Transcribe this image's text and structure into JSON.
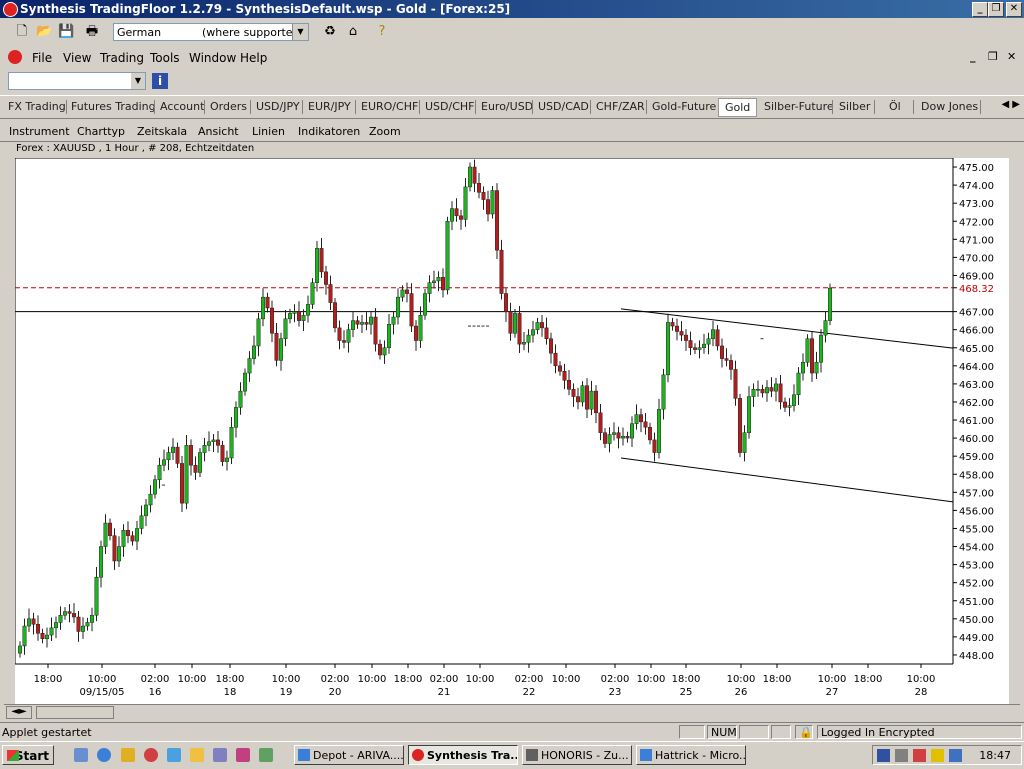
{
  "window": {
    "title": "Synthesis TradingFloor 1.2.79 - SynthesisDefault.wsp - Gold - [Forex:25]"
  },
  "toolbar": {
    "language_value": "German",
    "language_hint": "(where supported)"
  },
  "menu": [
    "File",
    "View",
    "Trading",
    "Tools",
    "Window",
    "Help"
  ],
  "tabs": [
    "FX Trading",
    "Futures Trading",
    "Account",
    "Orders",
    "USD/JPY",
    "EUR/JPY",
    "EURO/CHF",
    "USD/CHF",
    "Euro/USD",
    "USD/CAD",
    "CHF/ZAR",
    "Gold-Future",
    "Gold",
    "Silber-Future",
    "Silber",
    "Öl",
    "Dow Jones"
  ],
  "selected_tab": "Gold",
  "chart_menu": [
    "Instrument",
    "Charttyp",
    "Zeitskala",
    "Ansicht",
    "Linien",
    "Indikatoren",
    "Zoom"
  ],
  "chart_info": "Forex : XAUUSD , 1 Hour , # 208, Echtzeitdaten",
  "chart_data": {
    "type": "candlestick",
    "instrument": "XAUUSD",
    "ylim": [
      447.5,
      475.5
    ],
    "yticks": [
      "475.00",
      "474.00",
      "473.00",
      "472.00",
      "471.00",
      "470.00",
      "469.00",
      "468.32",
      "467.00",
      "466.00",
      "465.00",
      "464.00",
      "463.00",
      "462.00",
      "461.00",
      "460.00",
      "459.00",
      "458.00",
      "457.00",
      "456.00",
      "455.00",
      "454.00",
      "453.00",
      "452.00",
      "451.00",
      "450.00",
      "449.00",
      "448.00"
    ],
    "current_price": 468.32,
    "horizontal_line": 467.0,
    "xticks": [
      {
        "t": "18:00",
        "d": ""
      },
      {
        "t": "10:00",
        "d": "09/15/05"
      },
      {
        "t": "02:00",
        "d": "16"
      },
      {
        "t": "10:00",
        "d": ""
      },
      {
        "t": "18:00",
        "d": "18"
      },
      {
        "t": "10:00",
        "d": "19"
      },
      {
        "t": "02:00",
        "d": "20"
      },
      {
        "t": "10:00",
        "d": ""
      },
      {
        "t": "18:00",
        "d": ""
      },
      {
        "t": "02:00",
        "d": "21"
      },
      {
        "t": "10:00",
        "d": ""
      },
      {
        "t": "02:00",
        "d": "22"
      },
      {
        "t": "10:00",
        "d": ""
      },
      {
        "t": "02:00",
        "d": "23"
      },
      {
        "t": "10:00",
        "d": ""
      },
      {
        "t": "18:00",
        "d": "25"
      },
      {
        "t": "10:00",
        "d": "26"
      },
      {
        "t": "18:00",
        "d": ""
      },
      {
        "t": "10:00",
        "d": "27"
      },
      {
        "t": "18:00",
        "d": ""
      },
      {
        "t": "10:00",
        "d": "28"
      }
    ],
    "channel_upper": [
      {
        "bar": 134,
        "y": 467.15
      },
      {
        "bar": 207,
        "y": 465.0
      }
    ],
    "channel_lower": [
      {
        "bar": 134,
        "y": 458.9
      },
      {
        "bar": 207,
        "y": 456.5
      }
    ],
    "closes": [
      448.5,
      449.6,
      450.0,
      449.7,
      449.2,
      448.9,
      449.1,
      449.5,
      449.8,
      450.2,
      450.4,
      450.3,
      450.1,
      449.3,
      449.6,
      449.8,
      450.2,
      452.3,
      454.0,
      455.3,
      454.6,
      453.2,
      454.0,
      454.9,
      454.6,
      454.3,
      455.0,
      455.7,
      456.3,
      456.9,
      457.7,
      458.5,
      458.8,
      459.2,
      459.5,
      458.6,
      456.4,
      459.6,
      458.5,
      458.1,
      459.2,
      459.6,
      459.8,
      459.9,
      459.6,
      458.7,
      458.9,
      460.6,
      461.7,
      462.6,
      463.6,
      464.4,
      465.1,
      466.6,
      467.8,
      467.2,
      465.8,
      464.3,
      465.5,
      466.6,
      466.9,
      467.0,
      466.5,
      466.8,
      467.4,
      468.6,
      470.5,
      469.2,
      468.5,
      467.5,
      466.1,
      465.4,
      465.3,
      466.0,
      466.5,
      466.3,
      466.4,
      466.3,
      466.7,
      465.2,
      464.6,
      465.0,
      466.3,
      466.7,
      467.8,
      468.2,
      468.0,
      466.2,
      465.4,
      466.8,
      468.0,
      468.6,
      468.7,
      468.9,
      468.2,
      472.0,
      472.7,
      472.3,
      472.1,
      473.9,
      475.0,
      474.1,
      473.6,
      473.2,
      472.4,
      473.7,
      470.4,
      468.0,
      467.0,
      465.8,
      466.9,
      465.2,
      465.3,
      465.7,
      466.0,
      466.4,
      466.1,
      465.5,
      464.7,
      464.0,
      463.7,
      463.2,
      462.7,
      462.3,
      462.0,
      462.9,
      461.6,
      462.6,
      461.4,
      460.3,
      459.7,
      460.2,
      460.3,
      460.0,
      460.1,
      460.0,
      460.8,
      461.3,
      460.9,
      460.6,
      459.9,
      459.2,
      461.6,
      463.5,
      466.4,
      466.2,
      465.9,
      465.7,
      465.4,
      465.0,
      464.9,
      465.0,
      465.2,
      465.5,
      466.0,
      465.1,
      464.4,
      464.3,
      463.8,
      462.2,
      459.2,
      460.3,
      462.3,
      462.7,
      462.7,
      462.5,
      462.8,
      462.6,
      463.0,
      462.0,
      461.7,
      461.8,
      462.4,
      463.6,
      464.2,
      465.5,
      463.6,
      464.2,
      465.7,
      466.5,
      468.3
    ],
    "stray_dashes": [
      {
        "bar": 32,
        "y": 457.4
      },
      {
        "bar": 100,
        "y": 466.2
      },
      {
        "bar": 101,
        "y": 466.2
      },
      {
        "bar": 102,
        "y": 466.2
      },
      {
        "bar": 103,
        "y": 466.2
      },
      {
        "bar": 104,
        "y": 466.2
      },
      {
        "bar": 165,
        "y": 465.5
      }
    ]
  },
  "status": {
    "text": "Applet gestartet",
    "num": "NUM",
    "logged": "Logged In Encrypted"
  },
  "taskbar": {
    "start": "Start",
    "tasks": [
      "Depot - ARIVA....",
      "Synthesis Tra...",
      "HONORIS  -  Zu...",
      "Hattrick - Micro..."
    ],
    "time": "18:47"
  },
  "colors": {
    "up": "#1db51d",
    "down": "#b51d1d",
    "price_line": "#c00000"
  }
}
